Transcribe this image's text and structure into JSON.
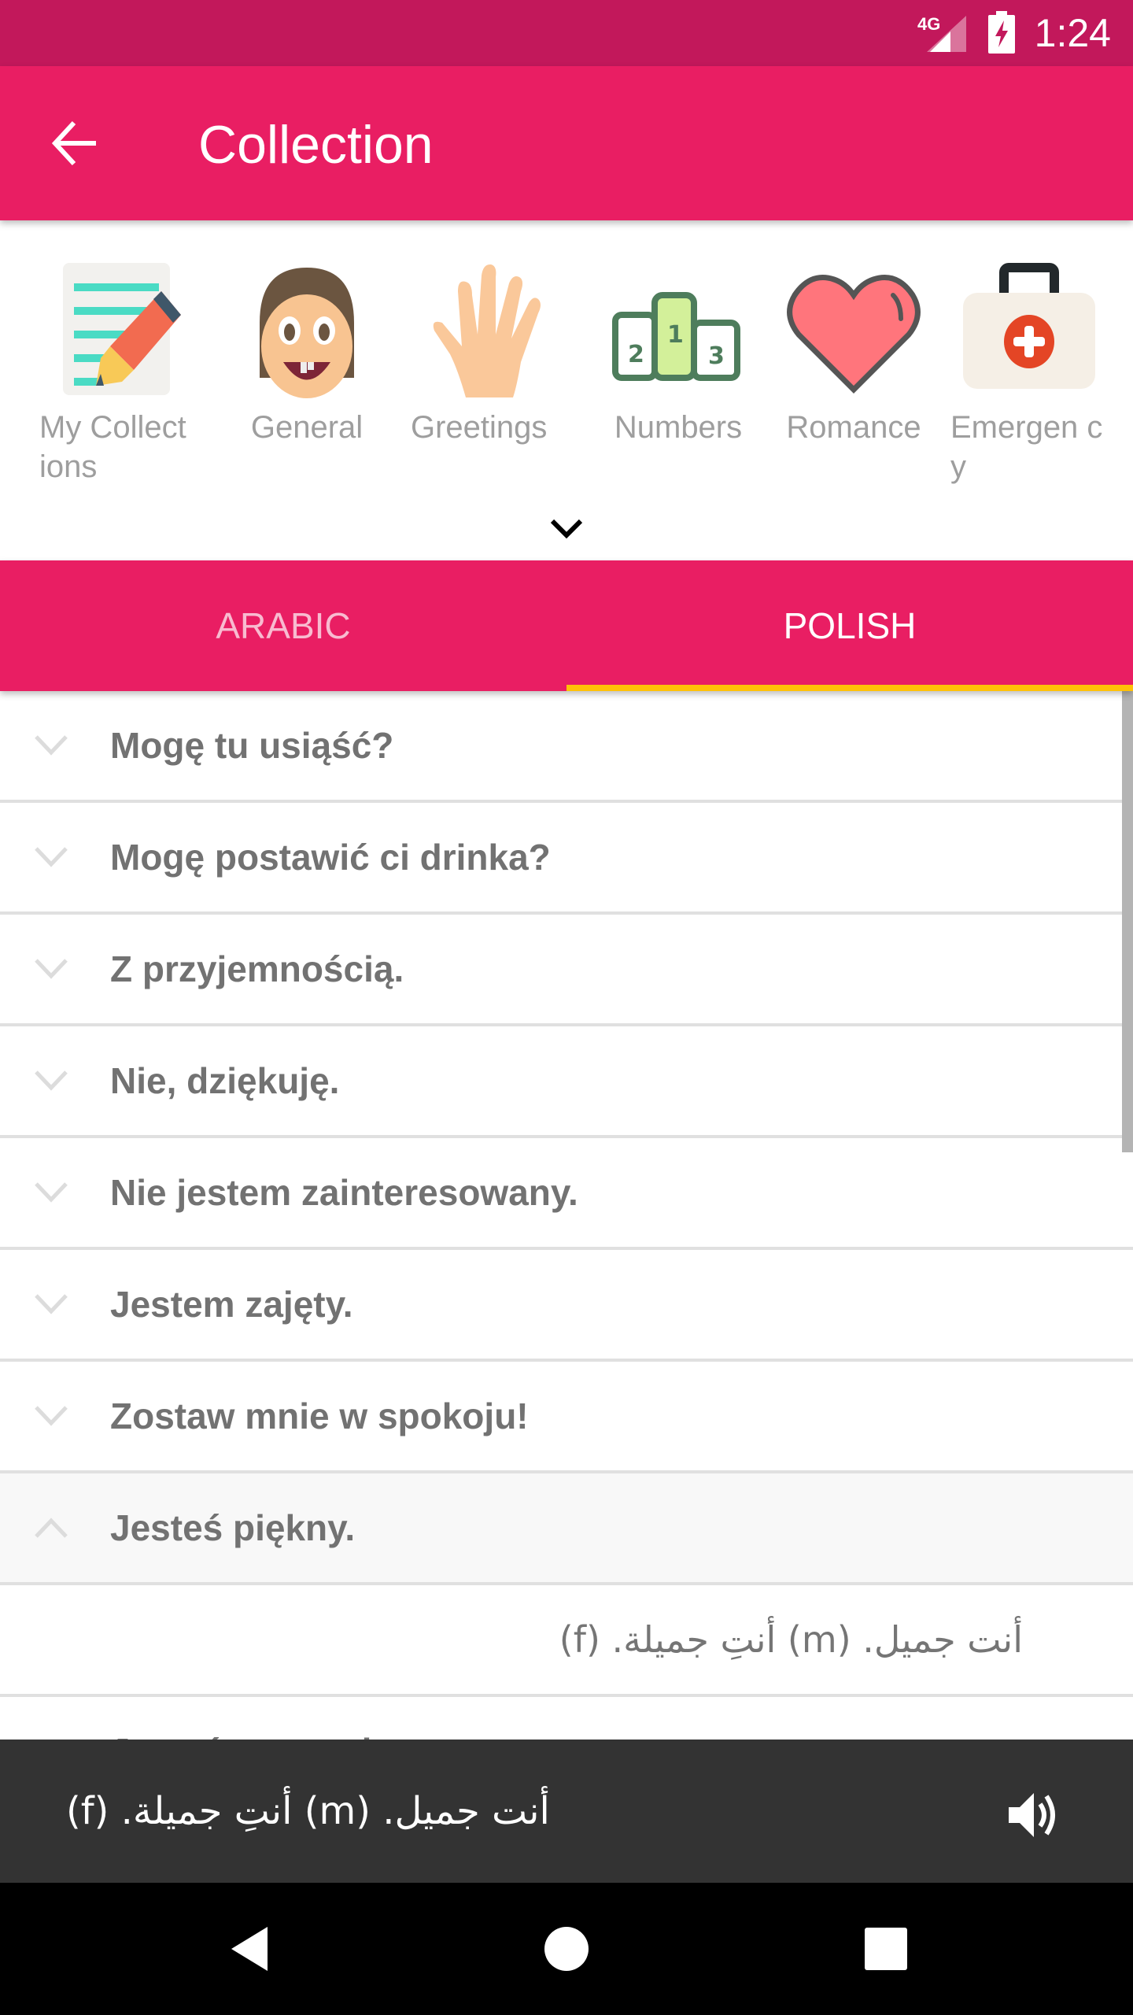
{
  "status_bar": {
    "network": "4G",
    "time": "1:24"
  },
  "app_bar": {
    "title": "Collection",
    "back_icon": "arrow-back-icon"
  },
  "categories": [
    {
      "label": "My Collect ions",
      "icon": "notepad-pencil-icon"
    },
    {
      "label": "General",
      "icon": "girl-face-icon"
    },
    {
      "label": "Greetings",
      "icon": "waving-hand-icon"
    },
    {
      "label": "Numbers",
      "icon": "podium-icon"
    },
    {
      "label": "Romance",
      "icon": "heart-icon"
    },
    {
      "label": "Emergen cy",
      "icon": "first-aid-kit-icon"
    }
  ],
  "tabs": [
    {
      "label": "ARABIC",
      "active": false
    },
    {
      "label": "POLISH",
      "active": true
    }
  ],
  "phrases": [
    "Mogę tu usiąść?",
    "Mogę postawić ci drinka?",
    "Z przyjemnością.",
    "Nie, dziękuję.",
    "Nie jestem zainteresowany.",
    "Jestem zajęty.",
    "Zostaw mnie w spokoju!",
    "Jesteś piękny.",
    "Jesteś przystojny."
  ],
  "expanded": {
    "phrase_index": 7,
    "translation": "أنت جميل. (m)  أنتِ جميلة. (f)"
  },
  "player": {
    "text": "أنت جميل. (m)  أنتِ جميلة. (f)",
    "icon": "speaker-icon"
  },
  "colors": {
    "status_bar": "#c2185b",
    "primary": "#e91e63",
    "tab_indicator": "#ffc107",
    "player_bg": "#333333"
  }
}
